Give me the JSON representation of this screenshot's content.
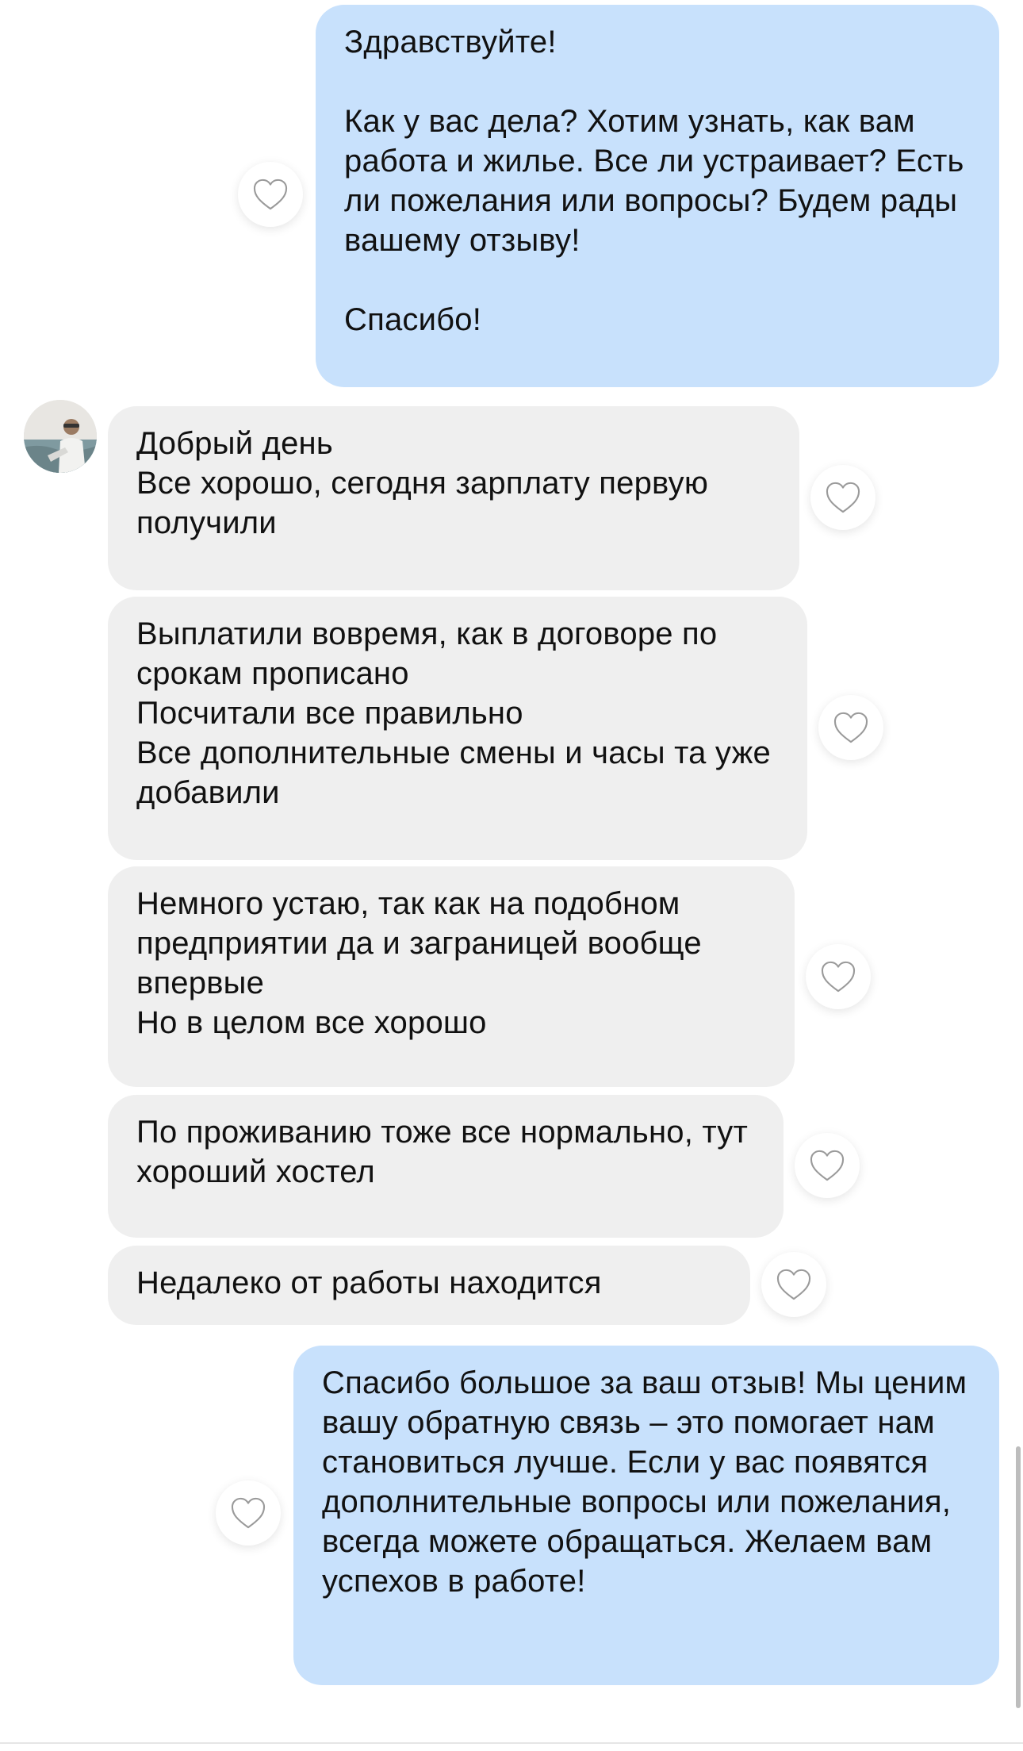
{
  "messages": [
    {
      "direction": "out",
      "text": "Здравствуйте!\n\nКак у вас дела? Хотим узнать, как вам работа и жилье. Все ли устраивает? Есть ли пожелания или вопросы? Будем рады вашему отзыву!\n\nСпасибо!"
    },
    {
      "direction": "in",
      "text": "Добрый день\nВсе хорошо, сегодня зарплату первую получили"
    },
    {
      "direction": "in",
      "text": "Выплатили вовремя, как в договоре по срокам прописано\nПосчитали все правильно\nВсе дополнительные смены и часы та уже добавили"
    },
    {
      "direction": "in",
      "text": "Немного устаю, так как на подобном предприятии да и заграницей вообще впервые\nНо в целом все хорошо"
    },
    {
      "direction": "in",
      "text": "По проживанию тоже все нормально, тут хороший хостел"
    },
    {
      "direction": "in",
      "text": "Недалеко от работы находится"
    },
    {
      "direction": "out",
      "text": "Спасибо большое за ваш отзыв! Мы ценим вашу обратную связь – это помогает нам становиться лучше. Если у вас появятся дополнительные вопросы или пожелания, всегда можете обращаться. Желаем вам успехов в работе!"
    }
  ],
  "icons": {
    "like": "heart-outline-icon",
    "avatar": "contact-avatar"
  },
  "colors": {
    "outgoing_bubble": "#c8e1fc",
    "incoming_bubble": "#efefef",
    "background": "#ffffff",
    "heart_stroke": "#9a9a9a"
  }
}
